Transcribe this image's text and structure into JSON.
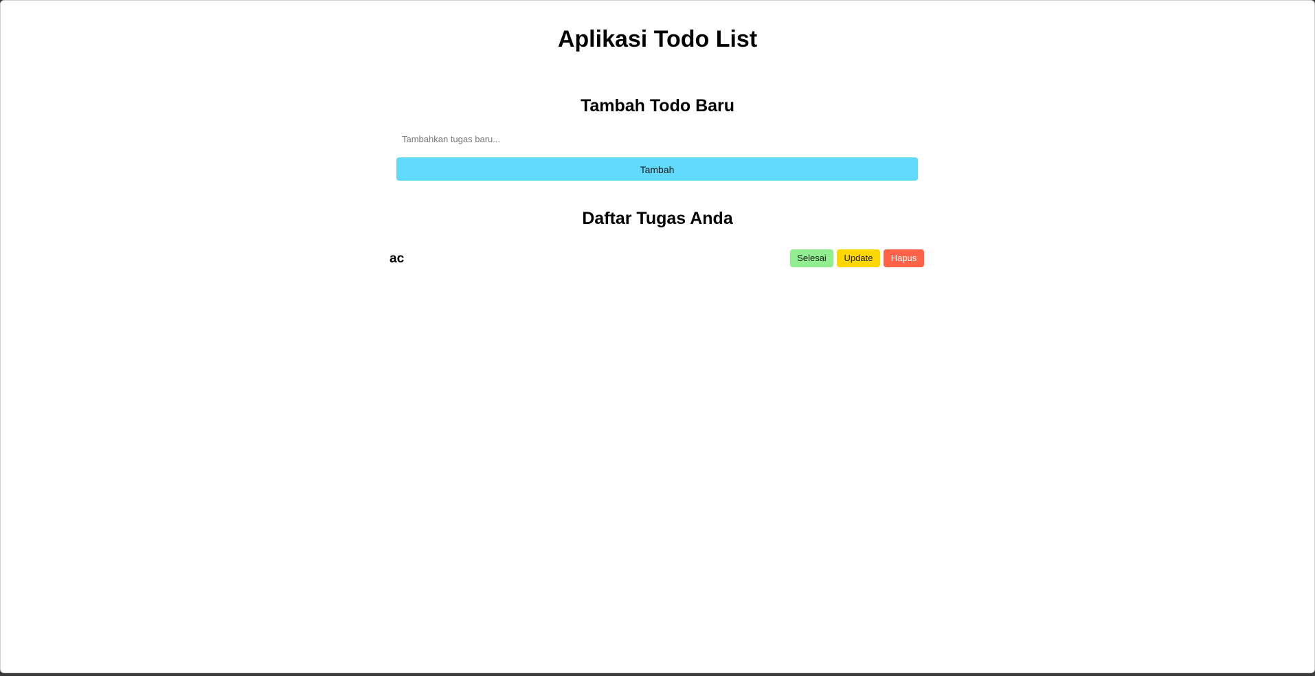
{
  "header": {
    "title": "Aplikasi Todo List"
  },
  "form": {
    "title": "Tambah Todo Baru",
    "input_placeholder": "Tambahkan tugas baru...",
    "input_value": "",
    "add_label": "Tambah"
  },
  "list": {
    "title": "Daftar Tugas Anda",
    "items": [
      {
        "text": "ac",
        "done_label": "Selesai",
        "update_label": "Update",
        "delete_label": "Hapus"
      }
    ]
  },
  "colors": {
    "add_button": "#61dafb",
    "done_button": "#90ee90",
    "update_button": "#ffd700",
    "delete_button": "#ff6347"
  }
}
